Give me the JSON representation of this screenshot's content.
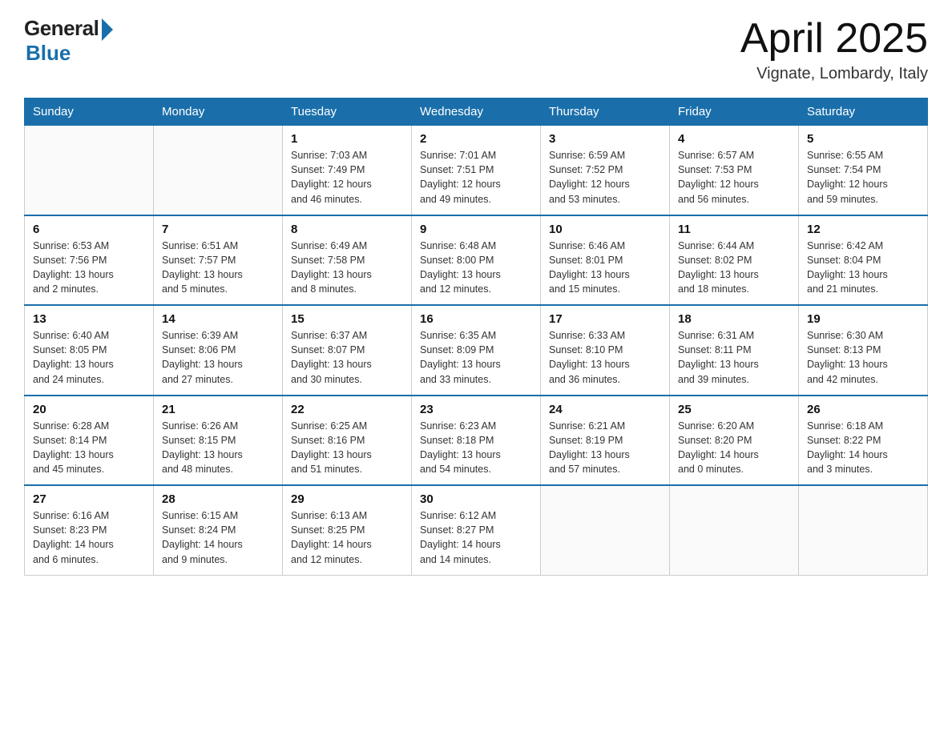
{
  "header": {
    "logo_general": "General",
    "logo_blue": "Blue",
    "month_year": "April 2025",
    "location": "Vignate, Lombardy, Italy"
  },
  "weekdays": [
    "Sunday",
    "Monday",
    "Tuesday",
    "Wednesday",
    "Thursday",
    "Friday",
    "Saturday"
  ],
  "weeks": [
    [
      {
        "day": "",
        "info": ""
      },
      {
        "day": "",
        "info": ""
      },
      {
        "day": "1",
        "info": "Sunrise: 7:03 AM\nSunset: 7:49 PM\nDaylight: 12 hours\nand 46 minutes."
      },
      {
        "day": "2",
        "info": "Sunrise: 7:01 AM\nSunset: 7:51 PM\nDaylight: 12 hours\nand 49 minutes."
      },
      {
        "day": "3",
        "info": "Sunrise: 6:59 AM\nSunset: 7:52 PM\nDaylight: 12 hours\nand 53 minutes."
      },
      {
        "day": "4",
        "info": "Sunrise: 6:57 AM\nSunset: 7:53 PM\nDaylight: 12 hours\nand 56 minutes."
      },
      {
        "day": "5",
        "info": "Sunrise: 6:55 AM\nSunset: 7:54 PM\nDaylight: 12 hours\nand 59 minutes."
      }
    ],
    [
      {
        "day": "6",
        "info": "Sunrise: 6:53 AM\nSunset: 7:56 PM\nDaylight: 13 hours\nand 2 minutes."
      },
      {
        "day": "7",
        "info": "Sunrise: 6:51 AM\nSunset: 7:57 PM\nDaylight: 13 hours\nand 5 minutes."
      },
      {
        "day": "8",
        "info": "Sunrise: 6:49 AM\nSunset: 7:58 PM\nDaylight: 13 hours\nand 8 minutes."
      },
      {
        "day": "9",
        "info": "Sunrise: 6:48 AM\nSunset: 8:00 PM\nDaylight: 13 hours\nand 12 minutes."
      },
      {
        "day": "10",
        "info": "Sunrise: 6:46 AM\nSunset: 8:01 PM\nDaylight: 13 hours\nand 15 minutes."
      },
      {
        "day": "11",
        "info": "Sunrise: 6:44 AM\nSunset: 8:02 PM\nDaylight: 13 hours\nand 18 minutes."
      },
      {
        "day": "12",
        "info": "Sunrise: 6:42 AM\nSunset: 8:04 PM\nDaylight: 13 hours\nand 21 minutes."
      }
    ],
    [
      {
        "day": "13",
        "info": "Sunrise: 6:40 AM\nSunset: 8:05 PM\nDaylight: 13 hours\nand 24 minutes."
      },
      {
        "day": "14",
        "info": "Sunrise: 6:39 AM\nSunset: 8:06 PM\nDaylight: 13 hours\nand 27 minutes."
      },
      {
        "day": "15",
        "info": "Sunrise: 6:37 AM\nSunset: 8:07 PM\nDaylight: 13 hours\nand 30 minutes."
      },
      {
        "day": "16",
        "info": "Sunrise: 6:35 AM\nSunset: 8:09 PM\nDaylight: 13 hours\nand 33 minutes."
      },
      {
        "day": "17",
        "info": "Sunrise: 6:33 AM\nSunset: 8:10 PM\nDaylight: 13 hours\nand 36 minutes."
      },
      {
        "day": "18",
        "info": "Sunrise: 6:31 AM\nSunset: 8:11 PM\nDaylight: 13 hours\nand 39 minutes."
      },
      {
        "day": "19",
        "info": "Sunrise: 6:30 AM\nSunset: 8:13 PM\nDaylight: 13 hours\nand 42 minutes."
      }
    ],
    [
      {
        "day": "20",
        "info": "Sunrise: 6:28 AM\nSunset: 8:14 PM\nDaylight: 13 hours\nand 45 minutes."
      },
      {
        "day": "21",
        "info": "Sunrise: 6:26 AM\nSunset: 8:15 PM\nDaylight: 13 hours\nand 48 minutes."
      },
      {
        "day": "22",
        "info": "Sunrise: 6:25 AM\nSunset: 8:16 PM\nDaylight: 13 hours\nand 51 minutes."
      },
      {
        "day": "23",
        "info": "Sunrise: 6:23 AM\nSunset: 8:18 PM\nDaylight: 13 hours\nand 54 minutes."
      },
      {
        "day": "24",
        "info": "Sunrise: 6:21 AM\nSunset: 8:19 PM\nDaylight: 13 hours\nand 57 minutes."
      },
      {
        "day": "25",
        "info": "Sunrise: 6:20 AM\nSunset: 8:20 PM\nDaylight: 14 hours\nand 0 minutes."
      },
      {
        "day": "26",
        "info": "Sunrise: 6:18 AM\nSunset: 8:22 PM\nDaylight: 14 hours\nand 3 minutes."
      }
    ],
    [
      {
        "day": "27",
        "info": "Sunrise: 6:16 AM\nSunset: 8:23 PM\nDaylight: 14 hours\nand 6 minutes."
      },
      {
        "day": "28",
        "info": "Sunrise: 6:15 AM\nSunset: 8:24 PM\nDaylight: 14 hours\nand 9 minutes."
      },
      {
        "day": "29",
        "info": "Sunrise: 6:13 AM\nSunset: 8:25 PM\nDaylight: 14 hours\nand 12 minutes."
      },
      {
        "day": "30",
        "info": "Sunrise: 6:12 AM\nSunset: 8:27 PM\nDaylight: 14 hours\nand 14 minutes."
      },
      {
        "day": "",
        "info": ""
      },
      {
        "day": "",
        "info": ""
      },
      {
        "day": "",
        "info": ""
      }
    ]
  ]
}
